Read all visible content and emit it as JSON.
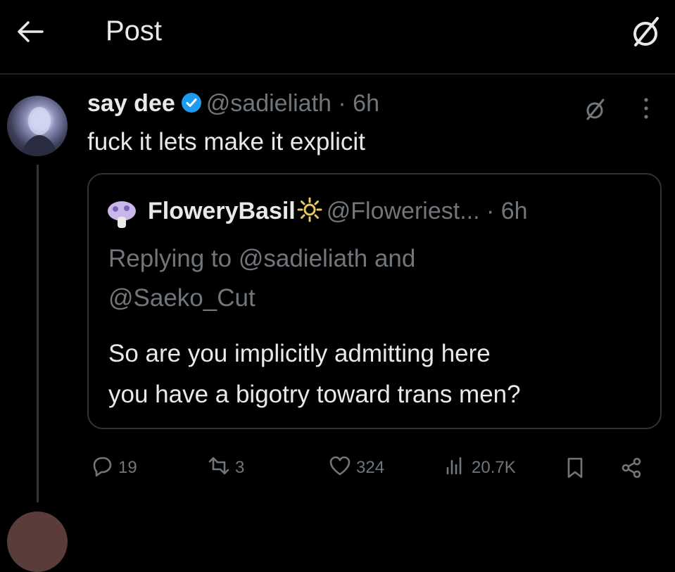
{
  "header": {
    "title": "Post"
  },
  "post": {
    "author_name": "say dee",
    "handle": "@sadieliath",
    "time": "· 6h",
    "text": "fuck it lets make it explicit"
  },
  "quote": {
    "author_name": "FloweryBasil",
    "handle": "@Floweriest...",
    "time": "· 6h",
    "replying_line1": "Replying to @sadieliath and",
    "replying_line2": "@Saeko_Cut",
    "body_line1": "So are you implicitly admitting here",
    "body_line2": "you have a bigotry toward trans men?"
  },
  "actions": {
    "replies": "19",
    "reposts": "3",
    "likes": "324",
    "views": "20.7K"
  },
  "colors": {
    "background": "#000000",
    "text": "#e7e9ea",
    "muted": "#71767b",
    "verified": "#1d9bf0",
    "border": "#2f3336"
  },
  "icons": [
    "back-arrow-icon",
    "grok-icon",
    "verified-badge-icon",
    "more-icon",
    "sun-icon",
    "reply-icon",
    "repost-icon",
    "like-icon",
    "views-icon",
    "bookmark-icon",
    "share-icon"
  ]
}
